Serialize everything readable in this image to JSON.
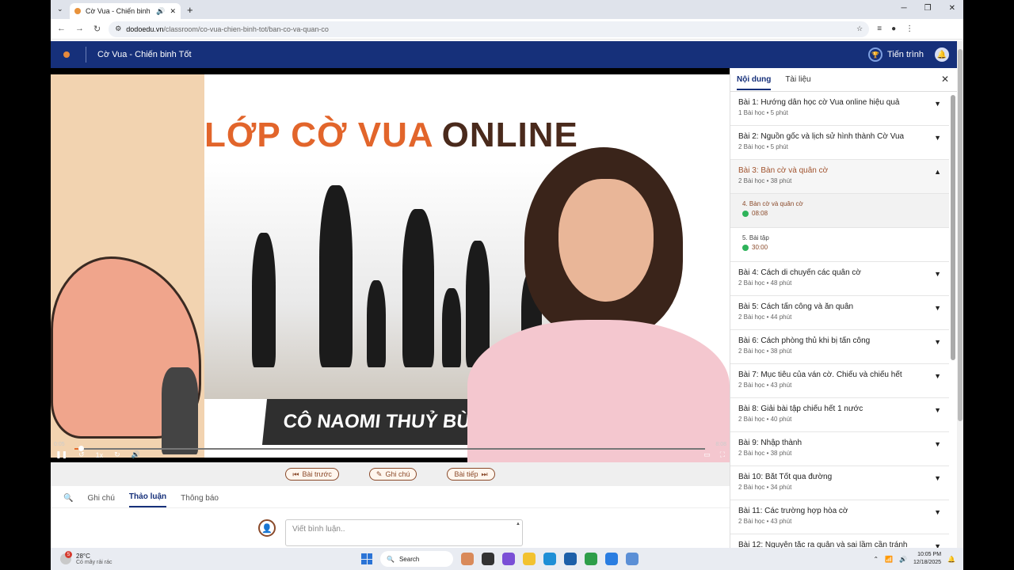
{
  "browser": {
    "tab_title": "Cờ Vua - Chiến binh Tốt",
    "url_host": "dodoedu.vn",
    "url_path": "/classroom/co-vua-chien-binh-tot/ban-co-va-quan-co"
  },
  "app": {
    "course_title": "Cờ Vua - Chiến binh Tốt",
    "progress_label": "Tiến trình"
  },
  "video": {
    "headline_part1": "LỚP CỜ VUA",
    "headline_part2": "ONLINE",
    "instructor": "CÔ NAOMI THUỶ BÙI",
    "current_time": "0:05",
    "duration": "8:08",
    "speed": "1x",
    "progress_fraction": 0.01
  },
  "lesson_nav": {
    "prev": "Bài trước",
    "notes": "Ghi chú",
    "next": "Bài tiếp"
  },
  "bottom_tabs": [
    "Ghi chú",
    "Thảo luận",
    "Thông báo"
  ],
  "comment": {
    "placeholder": "Viết bình luận.."
  },
  "sidebar": {
    "tabs": [
      "Nội dung",
      "Tài liệu"
    ],
    "lessons": [
      {
        "title": "Bài 1: Hướng dẫn học cờ Vua online hiệu quả",
        "meta": "1 Bài học • 5 phút"
      },
      {
        "title": "Bài 2: Nguồn gốc và lịch sử hình thành Cờ Vua",
        "meta": "2 Bài học • 5 phút"
      },
      {
        "title": "Bài 3: Bàn cờ và quân cờ",
        "meta": "2 Bài học • 38 phút"
      },
      {
        "title": "Bài 4: Cách di chuyển các quân cờ",
        "meta": "2 Bài học • 48 phút"
      },
      {
        "title": "Bài 5: Cách tấn công và ăn quân",
        "meta": "2 Bài học • 44 phút"
      },
      {
        "title": "Bài 6: Cách phòng thủ khi bị tấn công",
        "meta": "2 Bài học • 38 phút"
      },
      {
        "title": "Bài 7: Mục tiêu của ván cờ. Chiếu và chiếu hết",
        "meta": "2 Bài học • 43 phút"
      },
      {
        "title": "Bài 8: Giải bài tập chiếu hết 1 nước",
        "meta": "2 Bài học • 40 phút"
      },
      {
        "title": "Bài 9: Nhập thành",
        "meta": "2 Bài học • 38 phút"
      },
      {
        "title": "Bài 10: Bắt Tốt qua đường",
        "meta": "2 Bài học • 34 phút"
      },
      {
        "title": "Bài 11: Các trường hợp hòa cờ",
        "meta": "2 Bài học • 43 phút"
      },
      {
        "title": "Bài 12: Nguyên tắc ra quân và sai lầm cần tránh",
        "meta": ""
      }
    ],
    "sublessons": [
      {
        "title": "4. Bàn cờ và quân cờ",
        "duration": "08:08"
      },
      {
        "title": "5. Bài tập",
        "duration": "30:00"
      }
    ]
  },
  "taskbar": {
    "temperature": "28°C",
    "weather_text": "Có mây rải rác",
    "weather_badge": "5",
    "search_label": "Search",
    "time": "10:05 PM",
    "date": "12/18/2025"
  },
  "colors": {
    "brand": "#16307a",
    "accent": "#e2652b",
    "done": "#2eb35a"
  }
}
